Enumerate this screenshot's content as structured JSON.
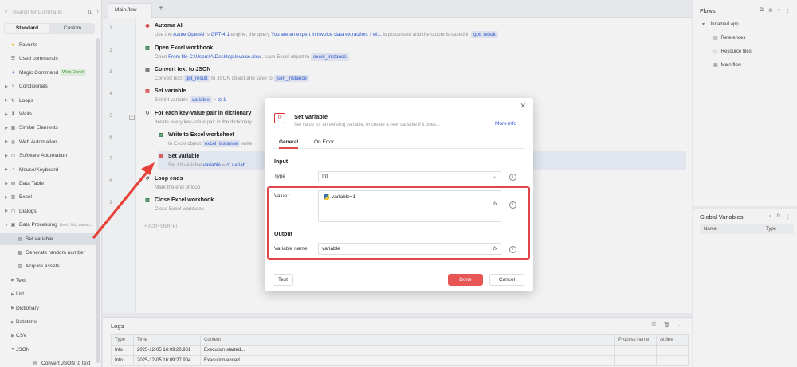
{
  "left_panel": {
    "search_placeholder": "Search for Command",
    "tabs": [
      "Standard",
      "Custom"
    ],
    "items": [
      {
        "label": "Favorite",
        "icon": "heart-icon",
        "caret": ""
      },
      {
        "label": "Used commands",
        "icon": "history-icon",
        "caret": ""
      },
      {
        "label": "Magic Command",
        "icon": "magic-icon",
        "caret": "",
        "badge": "Web Done!"
      },
      {
        "label": "Conditionals",
        "icon": "branch-icon",
        "caret": "▶"
      },
      {
        "label": "Loops",
        "icon": "loop-icon",
        "caret": "▶"
      },
      {
        "label": "Waits",
        "icon": "hourglass-icon",
        "caret": "▶"
      },
      {
        "label": "Similar Elements",
        "icon": "grid-icon",
        "caret": "▶"
      },
      {
        "label": "Web Automation",
        "icon": "globe-icon",
        "caret": "▶"
      },
      {
        "label": "Software Automation",
        "icon": "monitor-icon",
        "caret": "▶"
      },
      {
        "label": "Mouse/Keyboard",
        "icon": "mouse-icon",
        "caret": "▶"
      },
      {
        "label": "Data Table",
        "icon": "table-icon",
        "caret": "▶"
      },
      {
        "label": "Excel",
        "icon": "excel-icon",
        "caret": "▶"
      },
      {
        "label": "Dialogs",
        "icon": "dialog-icon",
        "caret": "▶"
      },
      {
        "label": "Data Processing",
        "icon": "data-icon",
        "caret": "▼",
        "sub": "(text, list, variab..."
      },
      {
        "label": "Set variable",
        "icon": "variable-icon",
        "caret": "",
        "indent": true,
        "selected": true
      },
      {
        "label": "Generate random number",
        "icon": "random-icon",
        "caret": "",
        "indent": true
      },
      {
        "label": "Acquire assets",
        "icon": "asset-icon",
        "caret": "",
        "indent": true
      },
      {
        "label": "Text",
        "icon": "",
        "caret": "▶",
        "indent": true
      },
      {
        "label": "List",
        "icon": "",
        "caret": "▶",
        "indent": true
      },
      {
        "label": "Dictionary",
        "icon": "",
        "caret": "▶",
        "indent": true
      },
      {
        "label": "Datetime",
        "icon": "",
        "caret": "▶",
        "indent": true
      },
      {
        "label": "CSV",
        "icon": "",
        "caret": "▶",
        "indent": true
      },
      {
        "label": "JSON",
        "icon": "",
        "caret": "▼",
        "indent": true
      },
      {
        "label": "Convert JSON to text",
        "icon": "json-icon",
        "caret": "",
        "indent2": true
      }
    ]
  },
  "editor": {
    "tab_label": "Main.flow",
    "add_tab": "+",
    "add_step_hint": "+ (Ctrl+Shift+P)",
    "steps": [
      {
        "num": "1",
        "title": "Automa AI",
        "icon": "ai-icon",
        "desc_parts": [
          "Use the ",
          {
            "hl": "Azure OpenAI"
          },
          " 's ",
          {
            "hl": "GPT-4.1"
          },
          " engine, the query ",
          {
            "hl": "You are an expert in invoice data extraction. I wi..."
          },
          " is processed and the output is saved in ",
          {
            "chip": "gpt_result"
          }
        ]
      },
      {
        "num": "2",
        "title": "Open Excel workbook",
        "icon": "excel-open-icon",
        "desc_parts": [
          "Open ",
          {
            "hl": "From file"
          },
          " ",
          {
            "hl": "C:\\Users\\A\\Desktop\\Invoice.xlsx"
          },
          " , save Excel object to ",
          {
            "chip": "excel_instance"
          }
        ]
      },
      {
        "num": "3",
        "title": "Convert text to JSON",
        "icon": "json-icon",
        "desc_parts": [
          "Convert text ",
          {
            "chip": "gpt_result"
          },
          " to JSON object and save to ",
          {
            "chip": "json_instance"
          }
        ]
      },
      {
        "num": "4",
        "title": "Set variable",
        "icon": "variable-icon",
        "desc_parts": [
          "Set Int variable ",
          {
            "chip": "variable"
          },
          " = ",
          {
            "hl": "⊙ 1"
          }
        ]
      },
      {
        "num": "5",
        "title": "For each key-value pair in dictionary",
        "icon": "loop-icon",
        "desc_parts": [
          "Iterate every key-value pair in the dictionary"
        ]
      },
      {
        "num": "6",
        "title": "Write to Excel worksheet",
        "icon": "excel-write-icon",
        "desc_parts": [
          "In Excel object ",
          {
            "chip": "excel_instance"
          },
          " write"
        ]
      },
      {
        "num": "7",
        "title": "Set variable",
        "icon": "variable-icon",
        "desc_parts": [
          "Set Int variable ",
          {
            "hl": "variable"
          },
          " = ",
          {
            "hl": "⊙ variab"
          }
        ]
      },
      {
        "num": "8",
        "title": "Loop ends",
        "icon": "loop-end-icon",
        "desc_parts": [
          "Mark the end of loop"
        ]
      },
      {
        "num": "9",
        "title": "Close Excel workbook",
        "icon": "excel-close-icon",
        "desc_parts": [
          "Close Excel workbook"
        ]
      }
    ]
  },
  "logs": {
    "title": "Logs",
    "columns": [
      "Type",
      "Time",
      "Content",
      "Process name",
      "At line"
    ],
    "rows": [
      [
        "Info",
        "2025-12-05 16:09:20.961",
        "Execution started...",
        "",
        ""
      ],
      [
        "Info",
        "2025-12-05 16:09:27.904",
        "Execution ended",
        "",
        ""
      ]
    ]
  },
  "flows": {
    "title": "Flows",
    "app_name": "Unnamed app",
    "items": [
      "References",
      "Resource files",
      "Main.flow"
    ]
  },
  "global_vars": {
    "title": "Global Variables",
    "columns": [
      "Name",
      "Type"
    ]
  },
  "modal": {
    "title": "Set variable",
    "subtitle": "Set value for an existing variable, or create a new variable if it does...",
    "more_info": "More info",
    "tabs": [
      "General",
      "On Error"
    ],
    "input_section": "Input",
    "type_label": "Type",
    "type_value": "Int",
    "value_label": "Value:",
    "value_text": "variable+1",
    "output_section": "Output",
    "varname_label": "Variable name:",
    "varname_value": "variable",
    "fx": "fx",
    "test_btn": "Test",
    "done_btn": "Done",
    "cancel_btn": "Cancel",
    "icon_text": "fx"
  },
  "colors": {
    "accent_red": "#e04848",
    "link_blue": "#2f5bd6",
    "annotation_arrow": "#e8413a"
  }
}
